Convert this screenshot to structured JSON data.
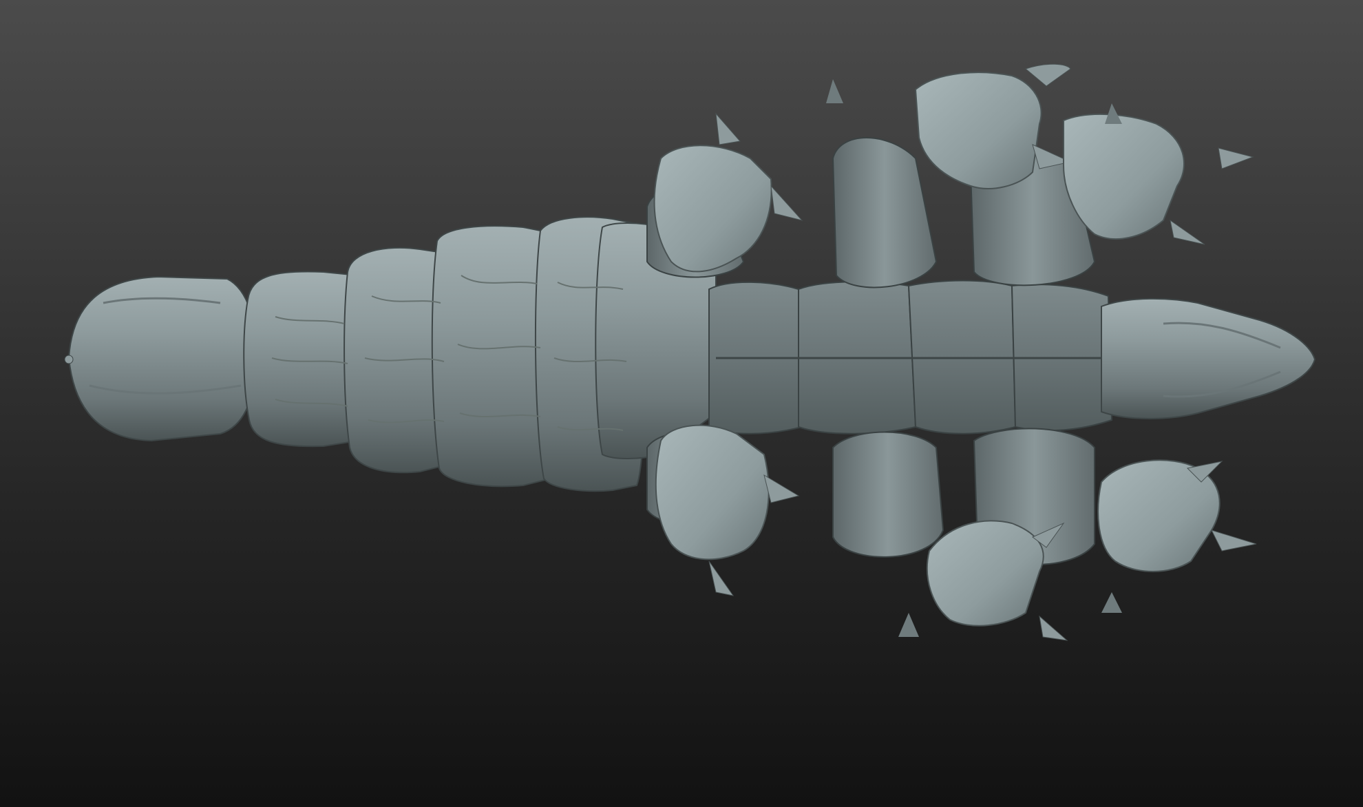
{
  "scene": {
    "subject": "sculpted-creature-underside",
    "material_color": "#8c9a9c",
    "shadow_color": "#4a5354",
    "background_top": "#4b4b4b",
    "background_bottom": "#121212"
  }
}
